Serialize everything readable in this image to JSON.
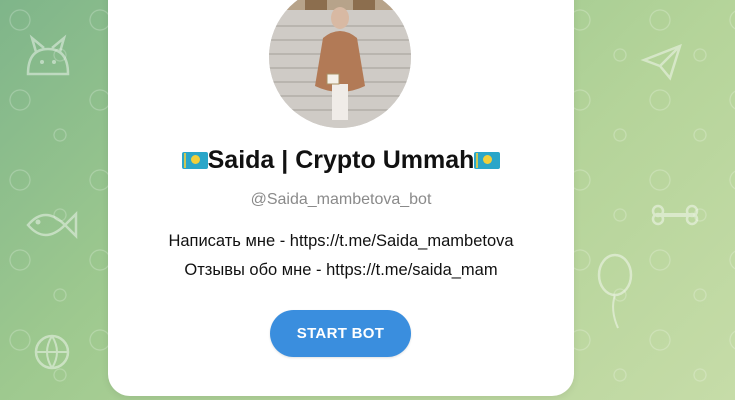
{
  "profile": {
    "name": "Saida | Crypto Ummah",
    "flag_left": "kazakhstan-flag",
    "flag_right": "kazakhstan-flag",
    "username": "@Saida_mambetova_bot",
    "description": [
      "Написать мне - https://t.me/Saida_mambetova",
      "Отзывы обо мне - https://t.me/saida_mam"
    ],
    "avatar": "profile-photo"
  },
  "actions": {
    "start_label": "START BOT"
  },
  "colors": {
    "background_start": "#7fb58a",
    "background_end": "#c6dca8",
    "card": "#ffffff",
    "button": "#3a8ede",
    "username": "#8a8a8a"
  }
}
